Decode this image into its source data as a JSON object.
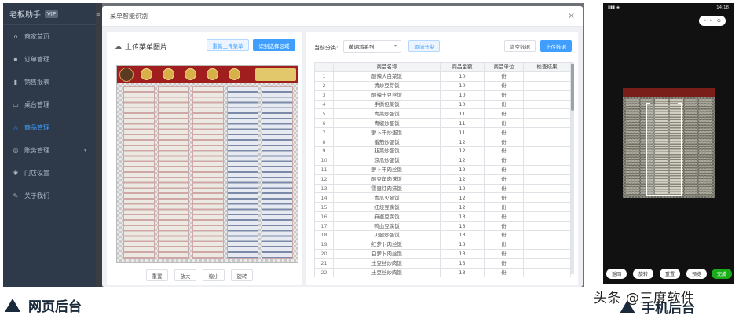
{
  "sidebar": {
    "brand": "老板助手",
    "version_badge": "VIP",
    "items": [
      {
        "label": "商家首页",
        "icon": "home-icon"
      },
      {
        "label": "订单管理",
        "icon": "order-icon"
      },
      {
        "label": "销售报表",
        "icon": "chart-icon"
      },
      {
        "label": "桌台管理",
        "icon": "table-icon"
      },
      {
        "label": "商品管理",
        "icon": "goods-icon",
        "active": true
      },
      {
        "label": "账务管理",
        "icon": "account-icon"
      },
      {
        "label": "门店设置",
        "icon": "gear-icon"
      },
      {
        "label": "关于我们",
        "icon": "info-icon"
      }
    ]
  },
  "modal": {
    "title": "菜单智能识别",
    "left": {
      "title": "上传菜单图片",
      "reupload_label": "重新上传菜单",
      "recognize_label": "识别选择区域",
      "reset_label": "重置",
      "zoom_in_label": "放大",
      "zoom_out_label": "缩小",
      "rotate_label": "旋转"
    },
    "right": {
      "category_label": "当前分类:",
      "category_value": "黄焖鸡系列",
      "add_category_label": "添加分类",
      "clear_label": "清空数据",
      "upload_label": "上传数据",
      "columns": [
        "",
        "商品名称",
        "商品金额",
        "商品单位",
        "检查结果"
      ],
      "rows": [
        [
          "1",
          "酸辣大白菜饭",
          "10",
          "份",
          ""
        ],
        [
          "2",
          "清炒豆芽饭",
          "10",
          "份",
          ""
        ],
        [
          "3",
          "酸辣土豆丝饭",
          "10",
          "份",
          ""
        ],
        [
          "4",
          "手撕包菜饭",
          "10",
          "份",
          ""
        ],
        [
          "5",
          "青菜炒蛋饭",
          "11",
          "份",
          ""
        ],
        [
          "6",
          "青椒炒蛋饭",
          "11",
          "份",
          ""
        ],
        [
          "7",
          "萝卜干炒蛋饭",
          "11",
          "份",
          ""
        ],
        [
          "8",
          "番茄炒蛋饭",
          "12",
          "份",
          ""
        ],
        [
          "9",
          "韭菜炒蛋饭",
          "12",
          "份",
          ""
        ],
        [
          "10",
          "凉瓜炒蛋饭",
          "12",
          "份",
          ""
        ],
        [
          "11",
          "萝卜干肉丝饭",
          "12",
          "份",
          ""
        ],
        [
          "12",
          "酸豆角肉沫饭",
          "12",
          "份",
          ""
        ],
        [
          "13",
          "雪里红肉沫饭",
          "12",
          "份",
          ""
        ],
        [
          "14",
          "青瓜火腿饭",
          "12",
          "份",
          ""
        ],
        [
          "15",
          "红烧豆腐饭",
          "12",
          "份",
          ""
        ],
        [
          "16",
          "麻婆豆腐饭",
          "13",
          "份",
          ""
        ],
        [
          "17",
          "鸭血豆腐饭",
          "13",
          "份",
          ""
        ],
        [
          "18",
          "火腿炒蛋饭",
          "13",
          "份",
          ""
        ],
        [
          "19",
          "红萝卜肉丝饭",
          "13",
          "份",
          ""
        ],
        [
          "20",
          "白萝卜肉丝饭",
          "13",
          "份",
          ""
        ],
        [
          "21",
          "土豆丝炒肉饭",
          "13",
          "份",
          ""
        ],
        [
          "22",
          "土豆丝炒肉饭",
          "13",
          "份",
          ""
        ]
      ]
    }
  },
  "labels": {
    "web": "网页后台",
    "phone": "手机后台",
    "watermark": "头条 @三度软件"
  },
  "phone": {
    "time": "14:18",
    "capsule_more": "•••",
    "capsule_close": "⊙",
    "buttons": [
      "返回",
      "旋转",
      "重置",
      "预览",
      "完成"
    ]
  },
  "colors": {
    "sidebar": "#2e3a4a",
    "accent": "#409eff",
    "menu_red": "#a01e1e",
    "done_green": "#1aad19"
  }
}
